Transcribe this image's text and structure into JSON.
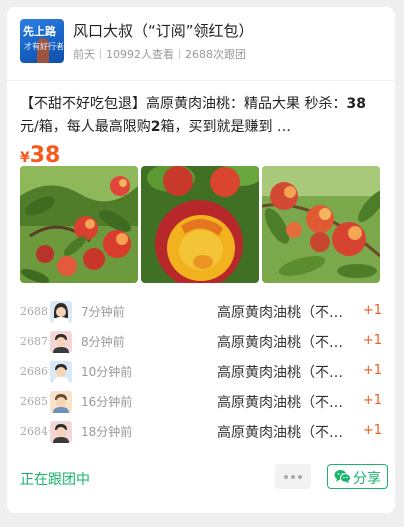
{
  "header": {
    "avatar_text_top": "先上路",
    "avatar_text_bottom": "才有好行者",
    "title": "风口大叔（“订阅”领红包）",
    "date": "前天",
    "views": "10992人查看",
    "follows": "2688次跟团"
  },
  "post": {
    "desc_prefix": "【不甜不好吃包退】高原黄肉油桃：精品大果 秒杀：",
    "desc_price": "38",
    "desc_mid": "元/箱，每人最高限购",
    "desc_limit": "2",
    "desc_suffix": "箱，买到就是赚到 …",
    "price_symbol": "¥",
    "price_value": "38",
    "photo_icons": [
      "peaches-on-tree-photo",
      "cut-peach-photo",
      "peaches-on-branch-photo"
    ]
  },
  "orders": [
    {
      "num": "2688",
      "time": "7分钟前",
      "product": "高原黄肉油桃（不…",
      "qty": "+1",
      "face": "woman-avatar"
    },
    {
      "num": "2687",
      "time": "8分钟前",
      "product": "高原黄肉油桃（不…",
      "qty": "+1",
      "face": "man-avatar"
    },
    {
      "num": "2686",
      "time": "10分钟前",
      "product": "高原黄肉油桃（不…",
      "qty": "+1",
      "face": "man-avatar"
    },
    {
      "num": "2685",
      "time": "16分钟前",
      "product": "高原黄肉油桃（不…",
      "qty": "+1",
      "face": "boy-avatar"
    },
    {
      "num": "2684",
      "time": "18分钟前",
      "product": "高原黄肉油桃（不…",
      "qty": "+1",
      "face": "man-avatar"
    }
  ],
  "footer": {
    "status": "正在跟团中",
    "more_icon": "more-dots-icon",
    "share_icon": "wechat-icon",
    "share_label": "分享"
  },
  "colors": {
    "accent_orange": "#f55a1c",
    "accent_green": "#18b46a",
    "avatar_blue": "#1763c7"
  }
}
